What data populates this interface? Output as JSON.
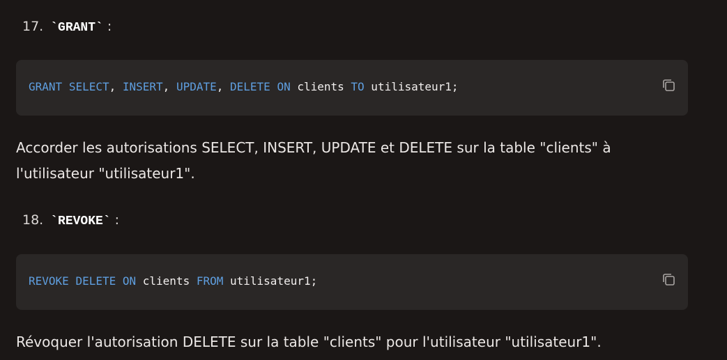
{
  "items": [
    {
      "number": "17.",
      "command": "`GRANT`",
      "colon": ":",
      "code_tokens": [
        {
          "t": "GRANT",
          "kw": true
        },
        {
          "t": " ",
          "kw": false
        },
        {
          "t": "SELECT",
          "kw": true
        },
        {
          "t": ", ",
          "kw": false
        },
        {
          "t": "INSERT",
          "kw": true
        },
        {
          "t": ", ",
          "kw": false
        },
        {
          "t": "UPDATE",
          "kw": true
        },
        {
          "t": ", ",
          "kw": false
        },
        {
          "t": "DELETE",
          "kw": true
        },
        {
          "t": " ",
          "kw": false
        },
        {
          "t": "ON",
          "kw": true
        },
        {
          "t": " clients ",
          "kw": false
        },
        {
          "t": "TO",
          "kw": true
        },
        {
          "t": " utilisateur1;",
          "kw": false
        }
      ],
      "description": "Accorder les autorisations SELECT, INSERT, UPDATE et DELETE sur la table \"clients\" à l'utilisateur \"utilisateur1\"."
    },
    {
      "number": "18.",
      "command": "`REVOKE`",
      "colon": ":",
      "code_tokens": [
        {
          "t": "REVOKE",
          "kw": true
        },
        {
          "t": " ",
          "kw": false
        },
        {
          "t": "DELETE",
          "kw": true
        },
        {
          "t": " ",
          "kw": false
        },
        {
          "t": "ON",
          "kw": true
        },
        {
          "t": " clients ",
          "kw": false
        },
        {
          "t": "FROM",
          "kw": true
        },
        {
          "t": " utilisateur1;",
          "kw": false
        }
      ],
      "description": "Révoquer l'autorisation DELETE sur la table \"clients\" pour l'utilisateur \"utilisateur1\"."
    }
  ],
  "icons": {
    "copy": "copy-icon"
  },
  "colors": {
    "keyword": "#5f9fe0",
    "code_bg": "#2a2726",
    "page_bg": "#1b1716"
  }
}
